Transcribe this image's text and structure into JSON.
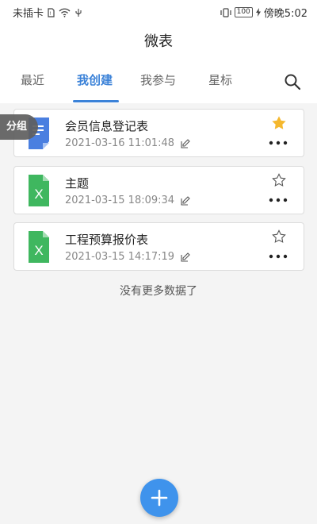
{
  "status_bar": {
    "carrier": "未插卡",
    "battery": "100",
    "time": "傍晚5:02"
  },
  "header": {
    "title": "微表"
  },
  "tabs": [
    {
      "label": "最近",
      "active": false
    },
    {
      "label": "我创建",
      "active": true
    },
    {
      "label": "我参与",
      "active": false
    },
    {
      "label": "星标",
      "active": false
    }
  ],
  "group_badge": "分组",
  "files": [
    {
      "name": "会员信息登记表",
      "datetime": "2021-03-16 11:01:48",
      "type": "doc",
      "starred": true
    },
    {
      "name": "主题",
      "datetime": "2021-03-15 18:09:34",
      "type": "excel",
      "starred": false
    },
    {
      "name": "工程预算报价表",
      "datetime": "2021-03-15 14:17:19",
      "type": "excel",
      "starred": false
    }
  ],
  "no_more_text": "没有更多数据了",
  "colors": {
    "accent": "#3b82d8",
    "fab": "#3f93ec",
    "excel": "#3fb75f",
    "doc": "#4a7fe0",
    "star_active": "#f5b82e"
  },
  "icons": {
    "search": "search-icon",
    "star": "star-icon",
    "more": "more-icon",
    "edit": "edit-icon",
    "add": "plus-icon"
  }
}
